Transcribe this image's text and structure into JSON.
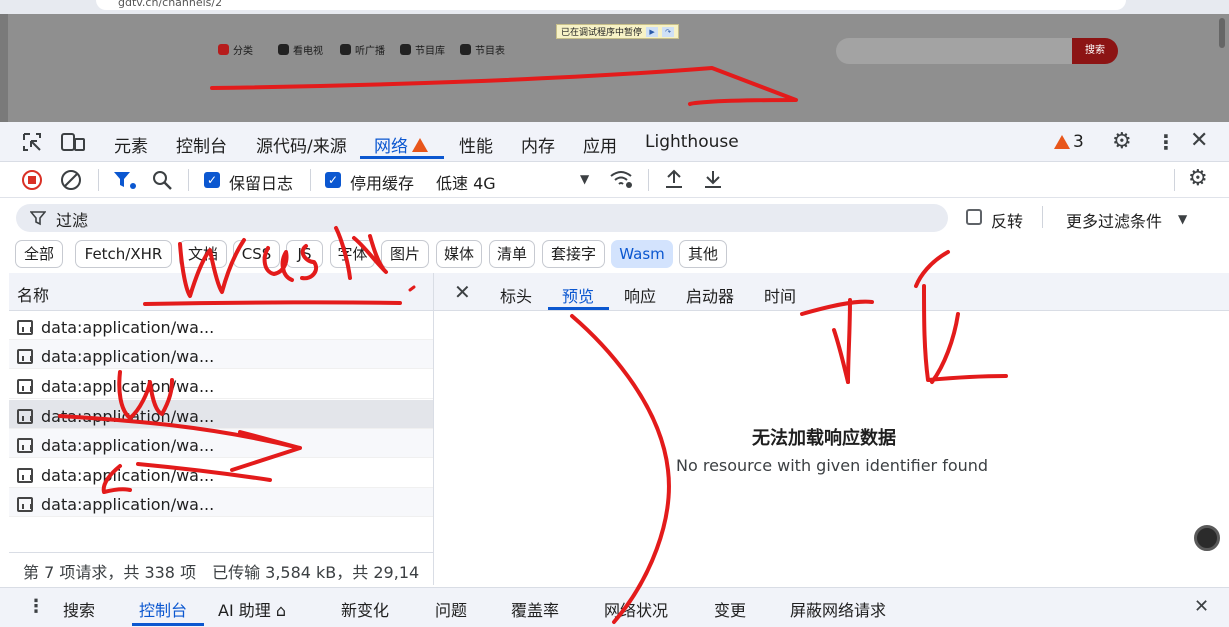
{
  "browser": {
    "url": "gdtv.cn/channels/2"
  },
  "site": {
    "nav": [
      {
        "label": "分类",
        "icon": "grid-icon"
      },
      {
        "label": "看电视",
        "icon": "tv-icon"
      },
      {
        "label": "听广播",
        "icon": "radio-icon"
      },
      {
        "label": "节目库",
        "icon": "library-icon"
      },
      {
        "label": "节目表",
        "icon": "schedule-icon"
      }
    ],
    "paused_banner": "已在调试程序中暂停",
    "search_button": "搜索"
  },
  "devtools": {
    "tabs": [
      "元素",
      "控制台",
      "源代码/来源",
      "网络",
      "性能",
      "内存",
      "应用",
      "Lighthouse"
    ],
    "active_tab": "网络",
    "warning_count": "3",
    "toolbar": {
      "preserve_log": "保留日志",
      "disable_cache": "停用缓存",
      "throttling": "低速 4G"
    },
    "filter": {
      "placeholder": "过滤",
      "invert": "反转",
      "more_filters": "更多过滤条件"
    },
    "chips": [
      "全部",
      "Fetch/XHR",
      "文档",
      "CSS",
      "JS",
      "字体",
      "图片",
      "媒体",
      "清单",
      "套接字",
      "Wasm",
      "其他"
    ],
    "active_chip": "Wasm",
    "list": {
      "header": "名称",
      "rows": [
        "data:application/wa...",
        "data:application/wa...",
        "data:application/wa...",
        "data:application/wa...",
        "data:application/wa...",
        "data:application/wa...",
        "data:application/wa..."
      ],
      "status": "第 7 项请求，共 338 项　已传输 3,584 kB，共 29,14"
    },
    "detail": {
      "tabs": [
        "标头",
        "预览",
        "响应",
        "启动器",
        "时间"
      ],
      "active": "预览",
      "message_title": "无法加载响应数据",
      "message_sub": "No resource with given identifier found"
    },
    "drawer": {
      "tabs": [
        "搜索",
        "控制台",
        "AI 助理 ⌂",
        "新变化",
        "问题",
        "覆盖率",
        "网络状况",
        "变更",
        "屏蔽网络请求"
      ],
      "active": "控制台"
    }
  },
  "colors": {
    "accent": "#0b57d0",
    "ink": "#e31b1b",
    "warning": "#e8561b"
  }
}
